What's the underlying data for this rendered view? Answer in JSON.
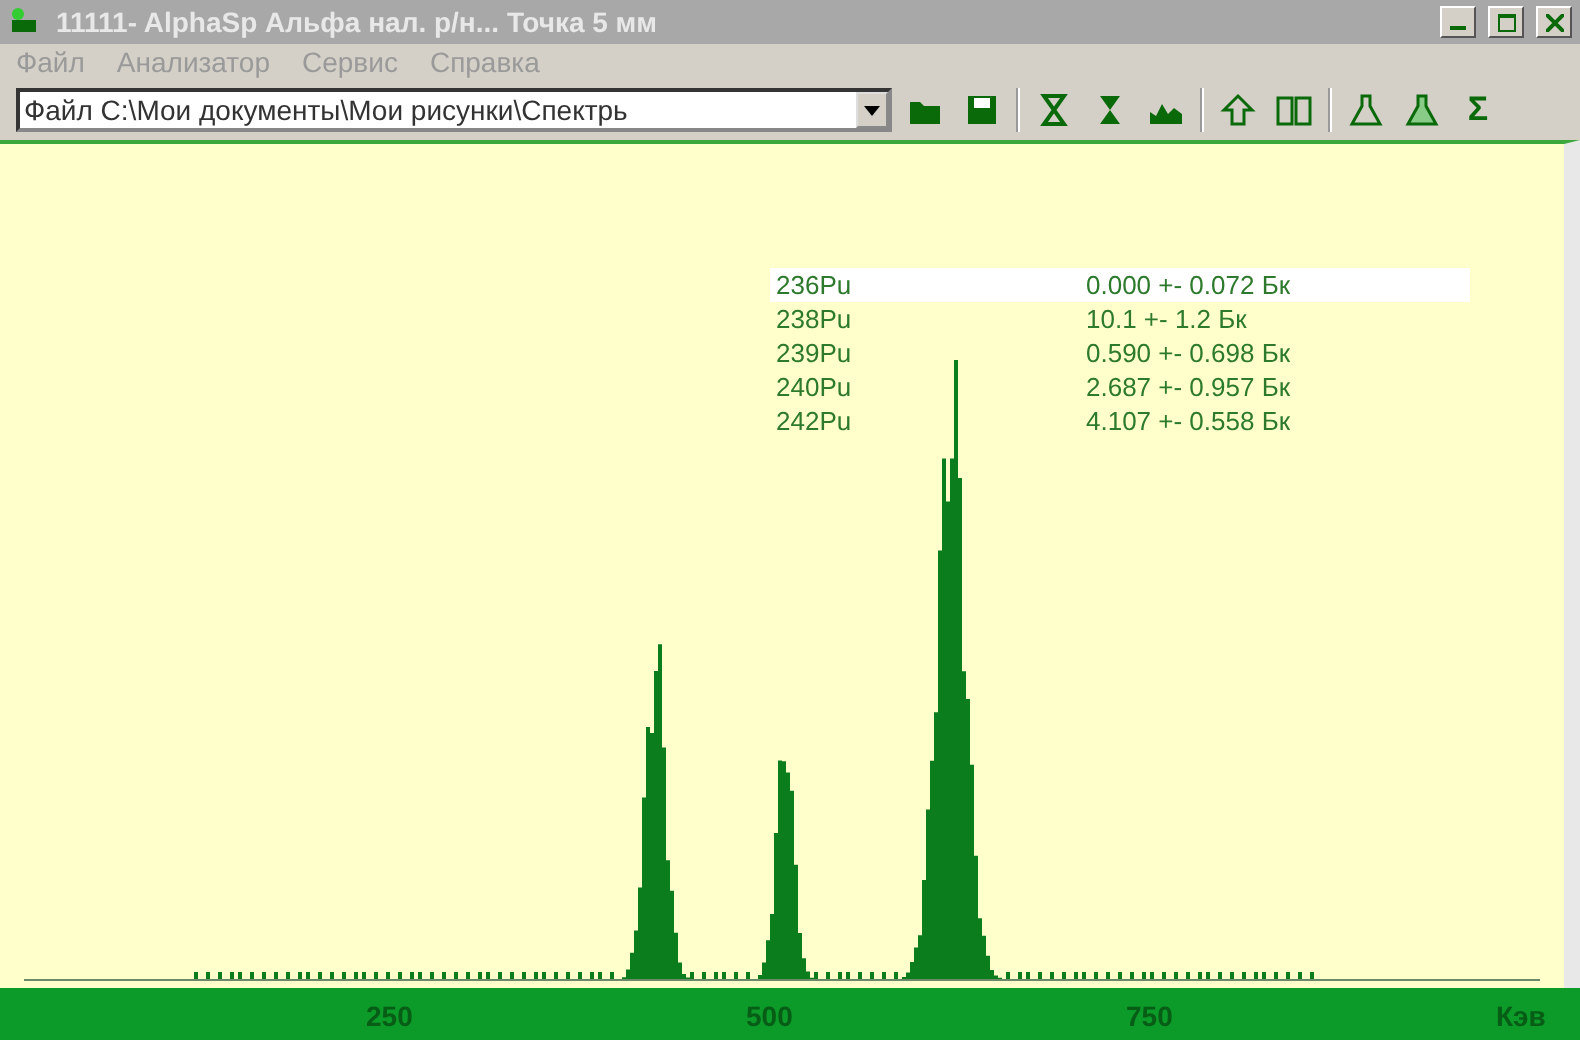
{
  "window": {
    "title": "11111-  AlphaSp   Альфа нал. р/н...   Точка 5 мм"
  },
  "menu": [
    "Файл",
    "Анализатор",
    "Сервис",
    "Справка"
  ],
  "toolbar": {
    "file_combo": "Файл C:\\Мои документы\\Мои рисунки\\Спектрь",
    "sigma": "Σ"
  },
  "results": [
    {
      "nuclide": "236Pu",
      "activity": "0.000 +- 0.072 Бк",
      "selected": true
    },
    {
      "nuclide": "238Pu",
      "activity": "10.1 +- 1.2 Бк",
      "selected": false
    },
    {
      "nuclide": "239Pu",
      "activity": "0.590 +- 0.698 Бк",
      "selected": false
    },
    {
      "nuclide": "240Pu",
      "activity": "2.687 +- 0.957 Бк",
      "selected": false
    },
    {
      "nuclide": "242Pu",
      "activity": "4.107 +- 0.558 Бк",
      "selected": false
    }
  ],
  "axis": {
    "ticks": [
      "250",
      "500",
      "750"
    ],
    "unit": "Кэв"
  }
}
